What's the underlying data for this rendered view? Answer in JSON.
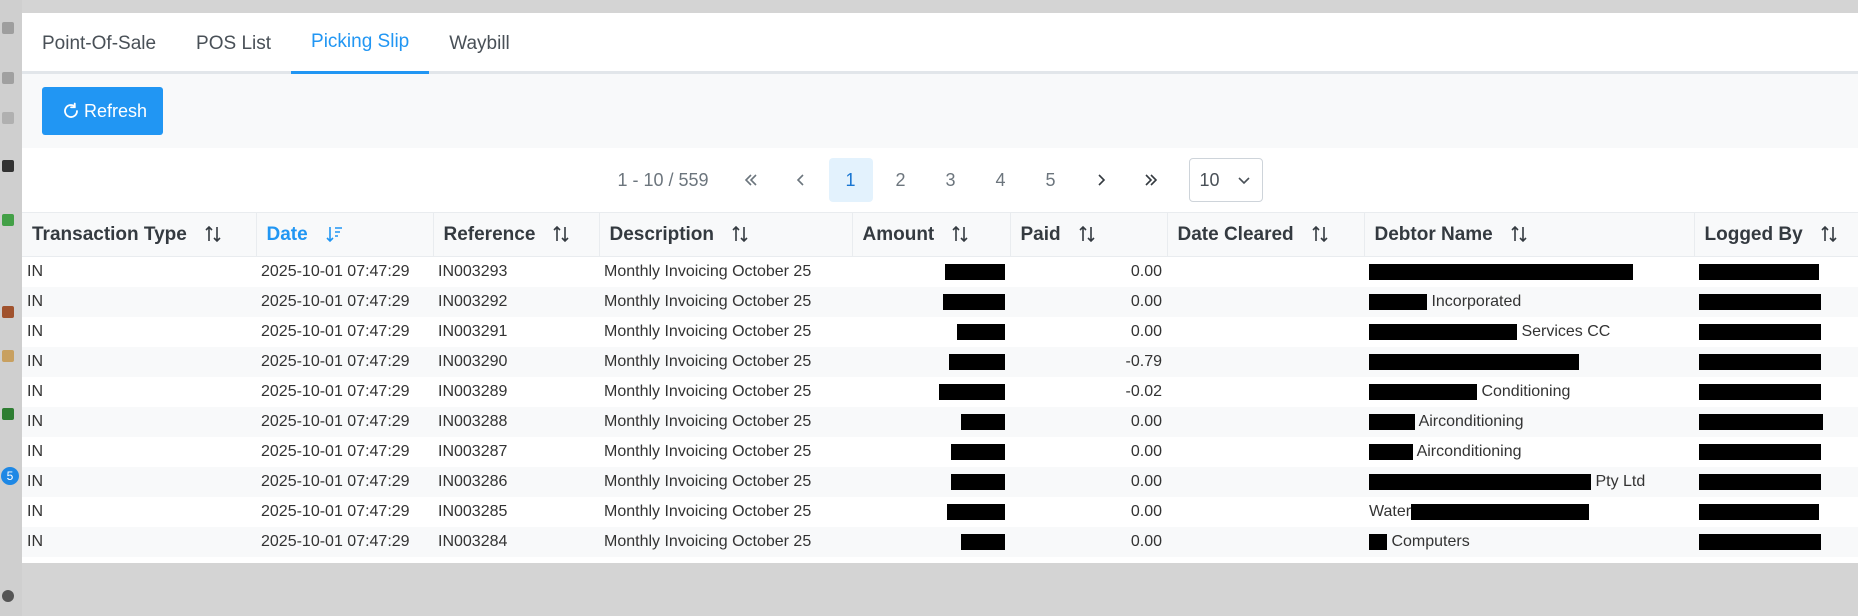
{
  "left_strip": {
    "badge_count": "5"
  },
  "tabs": [
    {
      "label": "Point-Of-Sale",
      "active": false
    },
    {
      "label": "POS List",
      "active": false
    },
    {
      "label": "Picking Slip",
      "active": true
    },
    {
      "label": "Waybill",
      "active": false
    }
  ],
  "toolbar": {
    "refresh_label": "Refresh",
    "refresh_icon": "refresh-icon"
  },
  "paginator": {
    "report": "1 - 10 / 559",
    "pages": [
      "1",
      "2",
      "3",
      "4",
      "5"
    ],
    "current_page": "1",
    "rows_per_page": "10"
  },
  "table": {
    "columns": [
      {
        "label": "Transaction Type",
        "sorted": false
      },
      {
        "label": "Date",
        "sorted": true
      },
      {
        "label": "Reference",
        "sorted": false
      },
      {
        "label": "Description",
        "sorted": false
      },
      {
        "label": "Amount",
        "sorted": false
      },
      {
        "label": "Paid",
        "sorted": false
      },
      {
        "label": "Date Cleared",
        "sorted": false
      },
      {
        "label": "Debtor Name",
        "sorted": false
      },
      {
        "label": "Logged By",
        "sorted": false
      }
    ],
    "rows": [
      {
        "type": "IN",
        "date": "2025-10-01 07:47:29",
        "reference": "IN003293",
        "description": "Monthly Invoicing October 25",
        "paid": "0.00",
        "debtor_text": ""
      },
      {
        "type": "IN",
        "date": "2025-10-01 07:47:29",
        "reference": "IN003292",
        "description": "Monthly Invoicing October 25",
        "paid": "0.00",
        "debtor_text": "Incorporated"
      },
      {
        "type": "IN",
        "date": "2025-10-01 07:47:29",
        "reference": "IN003291",
        "description": "Monthly Invoicing October 25",
        "paid": "0.00",
        "debtor_text": "Services CC"
      },
      {
        "type": "IN",
        "date": "2025-10-01 07:47:29",
        "reference": "IN003290",
        "description": "Monthly Invoicing October 25",
        "paid": "-0.79",
        "debtor_text": ""
      },
      {
        "type": "IN",
        "date": "2025-10-01 07:47:29",
        "reference": "IN003289",
        "description": "Monthly Invoicing October 25",
        "paid": "-0.02",
        "debtor_text": "Conditioning"
      },
      {
        "type": "IN",
        "date": "2025-10-01 07:47:29",
        "reference": "IN003288",
        "description": "Monthly Invoicing October 25",
        "paid": "0.00",
        "debtor_text": "Airconditioning"
      },
      {
        "type": "IN",
        "date": "2025-10-01 07:47:29",
        "reference": "IN003287",
        "description": "Monthly Invoicing October 25",
        "paid": "0.00",
        "debtor_text": "Airconditioning"
      },
      {
        "type": "IN",
        "date": "2025-10-01 07:47:29",
        "reference": "IN003286",
        "description": "Monthly Invoicing October 25",
        "paid": "0.00",
        "debtor_text": "Pty Ltd"
      },
      {
        "type": "IN",
        "date": "2025-10-01 07:47:29",
        "reference": "IN003285",
        "description": "Monthly Invoicing October 25",
        "paid": "0.00",
        "debtor_text": "Water"
      },
      {
        "type": "IN",
        "date": "2025-10-01 07:47:29",
        "reference": "IN003284",
        "description": "Monthly Invoicing October 25",
        "paid": "0.00",
        "debtor_text": "Computers"
      }
    ]
  }
}
